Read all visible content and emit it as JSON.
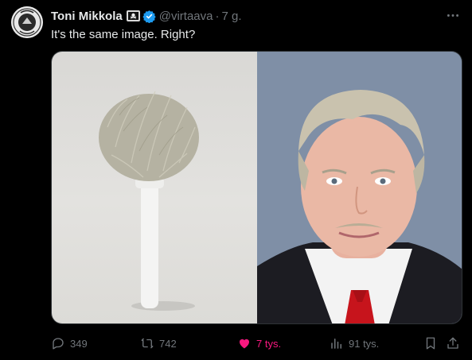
{
  "tweet": {
    "author_name": "Toni Mikkola",
    "handle": "@virtaava",
    "separator": "·",
    "time": "7 g.",
    "text": "It's the same image. Right?",
    "media_left": "toilet brush photo",
    "media_right": "portrait photo of a man in suit with red tie"
  },
  "actions": {
    "replies": "349",
    "reposts": "742",
    "likes": "7 tys.",
    "views": "91 tys."
  },
  "colors": {
    "background": "#000000",
    "text": "#e7e9ea",
    "muted": "#71767b",
    "verified": "#1d9bf0",
    "like": "#f91880"
  },
  "icons": [
    "avatar-seal",
    "pirate-flag-icon",
    "verified-badge-icon",
    "more-icon",
    "reply-icon",
    "repost-icon",
    "like-icon",
    "views-icon",
    "bookmark-icon",
    "share-icon"
  ]
}
